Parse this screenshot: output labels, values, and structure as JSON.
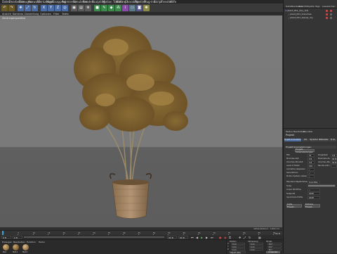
{
  "menubar": {
    "items": [
      "Datei",
      "Bearbeiten",
      "Erzeugen",
      "Auswahl",
      "Werkzeuge",
      "Mesh",
      "Snapping",
      "Animieren",
      "Simulieren",
      "Rendern",
      "Sculpting",
      "Motion Tracker",
      "MoGraph",
      "Charakter",
      "Pipeline",
      "Plug-ins",
      "Skript",
      "Fenster",
      "Hilfe"
    ]
  },
  "viewport": {
    "menu": [
      "Ansicht",
      "Kameras",
      "Darstellung",
      "Optionen",
      "Filter",
      "Tafeln"
    ],
    "label": "Zentralperspektive",
    "status": "Gitterabstand : 1000 cm"
  },
  "timeline": {
    "ticks": [
      "0",
      "5",
      "10",
      "15",
      "20",
      "25",
      "30",
      "35",
      "40",
      "45",
      "50",
      "55",
      "60",
      "65",
      "70",
      "75",
      "80",
      "85",
      "90"
    ],
    "end_frame": "90 B",
    "current": "0 B"
  },
  "transport": {
    "start": "0 B",
    "min": "0 B",
    "max": "90 B",
    "end": "90 B"
  },
  "materials": {
    "menu": [
      "Erzeugen",
      "Bearbeiten",
      "Funktion",
      "Textur"
    ],
    "names": [
      "Mat",
      "Mat.1",
      "Mat.2"
    ]
  },
  "coords": {
    "headers": [
      "Position",
      "Abmessung",
      "Winkel"
    ],
    "rows": [
      [
        "X",
        "0 cm",
        "0 cm",
        "H 0 °"
      ],
      [
        "Y",
        "0 cm",
        "0 cm",
        "P 0 °"
      ],
      [
        "Z",
        "0 cm",
        "0 cm",
        "B 0 °"
      ]
    ],
    "mode": "Objekt (Rel)",
    "apply": "Anwenden"
  },
  "object_manager": {
    "tabs": [
      "Datei",
      "Bearbeiten",
      "Ansicht",
      "Objekte",
      "Tags",
      "Lesezeichen"
    ],
    "items": [
      "plant_001_(dry_old)",
      "plant_001_branches",
      "plant_001_leaves_dry"
    ]
  },
  "attributes": {
    "menu": [
      "Modus",
      "Bearbeiten",
      "Benutzer"
    ],
    "title": "Projekt",
    "tabs": [
      "Projekt-Voreinstellungen",
      "Info",
      "Dynamics",
      "Referenzieren",
      "To Do"
    ],
    "section": "Projekt-Voreinstellungen",
    "rows": [
      {
        "label": "FPS",
        "value": "30"
      },
      {
        "label": "Minimale Zeit",
        "value": "0 B"
      },
      {
        "label": "Vorschau-Min-Zeit",
        "value": "0 B"
      },
      {
        "label": "Level of Detail",
        "value": "100 %"
      },
      {
        "label": "Animation abspielen",
        "value": "✓"
      },
      {
        "label": "Generatoren",
        "value": "✓"
      },
      {
        "label": "Motion System nutzen",
        "value": "✓"
      }
    ],
    "right_labels": [
      "Projektzeit",
      "Maximale Zeit",
      "Vorschau-Max-Zeit",
      "Render-LOD im Editor"
    ],
    "right_values": [
      "0 B",
      "90 B",
      "90 B",
      ""
    ],
    "more_rows": [
      {
        "label": "Standard-Objekt-Farbe",
        "value": "Grau-Blau"
      },
      {
        "label": "Farbe",
        "value": ""
      },
      {
        "label": "Linear Workflow",
        "value": "✓"
      },
      {
        "label": "Farbprofil",
        "value": "sRGB"
      },
      {
        "label": "Input-Color-Profile",
        "value": "sRGB"
      }
    ],
    "buttons": [
      "Lade Preset...",
      "Sichere Preset..."
    ]
  }
}
